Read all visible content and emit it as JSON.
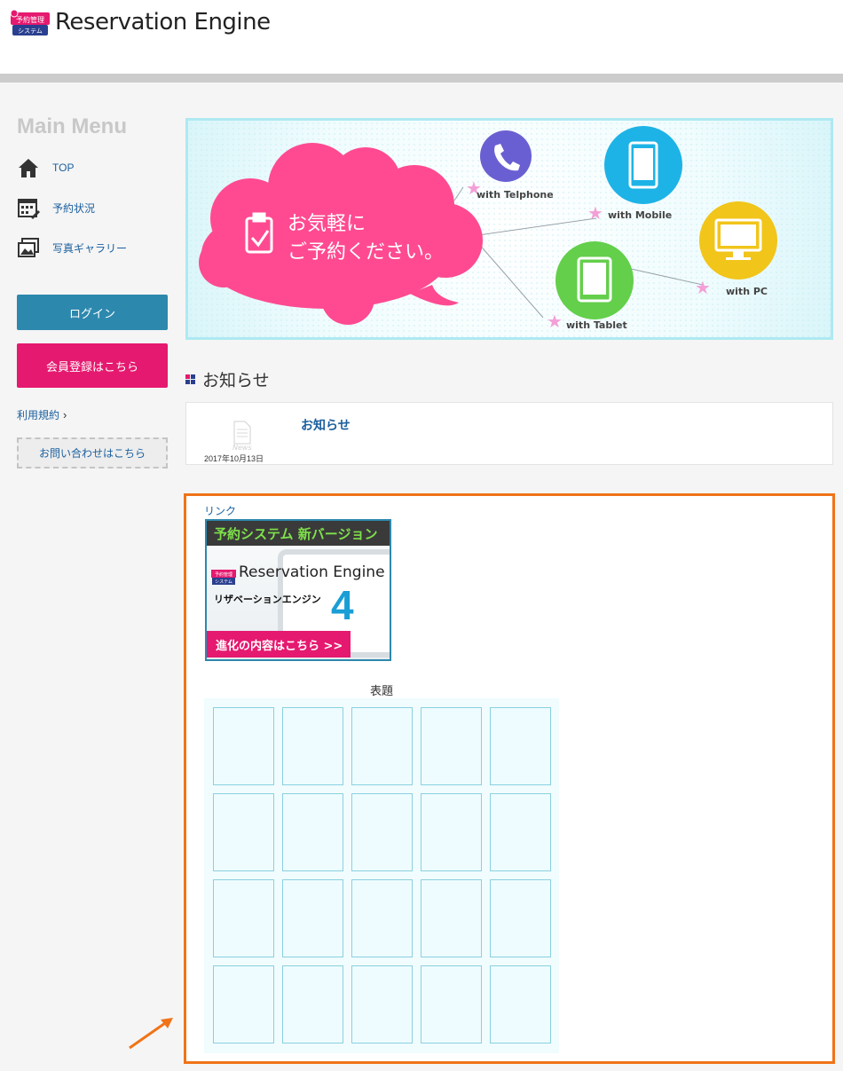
{
  "header": {
    "logo_badge_top": "予約管理",
    "logo_badge_bottom": "システム",
    "logo_text": "Reservation Engine"
  },
  "sidebar": {
    "menu_title": "Main Menu",
    "items": [
      {
        "label": "TOP",
        "icon": "home-icon"
      },
      {
        "label": "予約状況",
        "icon": "calendar-icon"
      },
      {
        "label": "写真ギャラリー",
        "icon": "gallery-icon"
      }
    ],
    "login_label": "ログイン",
    "register_label": "会員登録はこちら",
    "terms_label": "利用規約",
    "contact_label": "お問い合わせはこちら"
  },
  "hero": {
    "cloud_line1": "お気軽に",
    "cloud_line2": "ご予約ください。",
    "devices": [
      {
        "label": "with Telphone",
        "icon": "phone-icon"
      },
      {
        "label": "with Mobile",
        "icon": "mobile-icon"
      },
      {
        "label": "with PC",
        "icon": "pc-icon"
      },
      {
        "label": "with Tablet",
        "icon": "tablet-icon"
      }
    ]
  },
  "news": {
    "heading": "お知らせ",
    "doc_label": "News",
    "date": "2017年10月13日",
    "title": "お知らせ"
  },
  "links": {
    "label": "リンク",
    "promo": {
      "top_text": "予約システム 新バージョン",
      "badge_top": "予約管理",
      "badge_bottom": "システム",
      "logo_text": "Reservation Engine",
      "sub_text": "リザベーションエンジン",
      "version": "4",
      "button_text": "進化の内容はこちら >>"
    },
    "grid_title": "表題"
  },
  "colors": {
    "accent_blue": "#2d88ad",
    "accent_pink": "#e5196f",
    "highlight_orange": "#f07318",
    "link_blue": "#1a5f9e"
  }
}
